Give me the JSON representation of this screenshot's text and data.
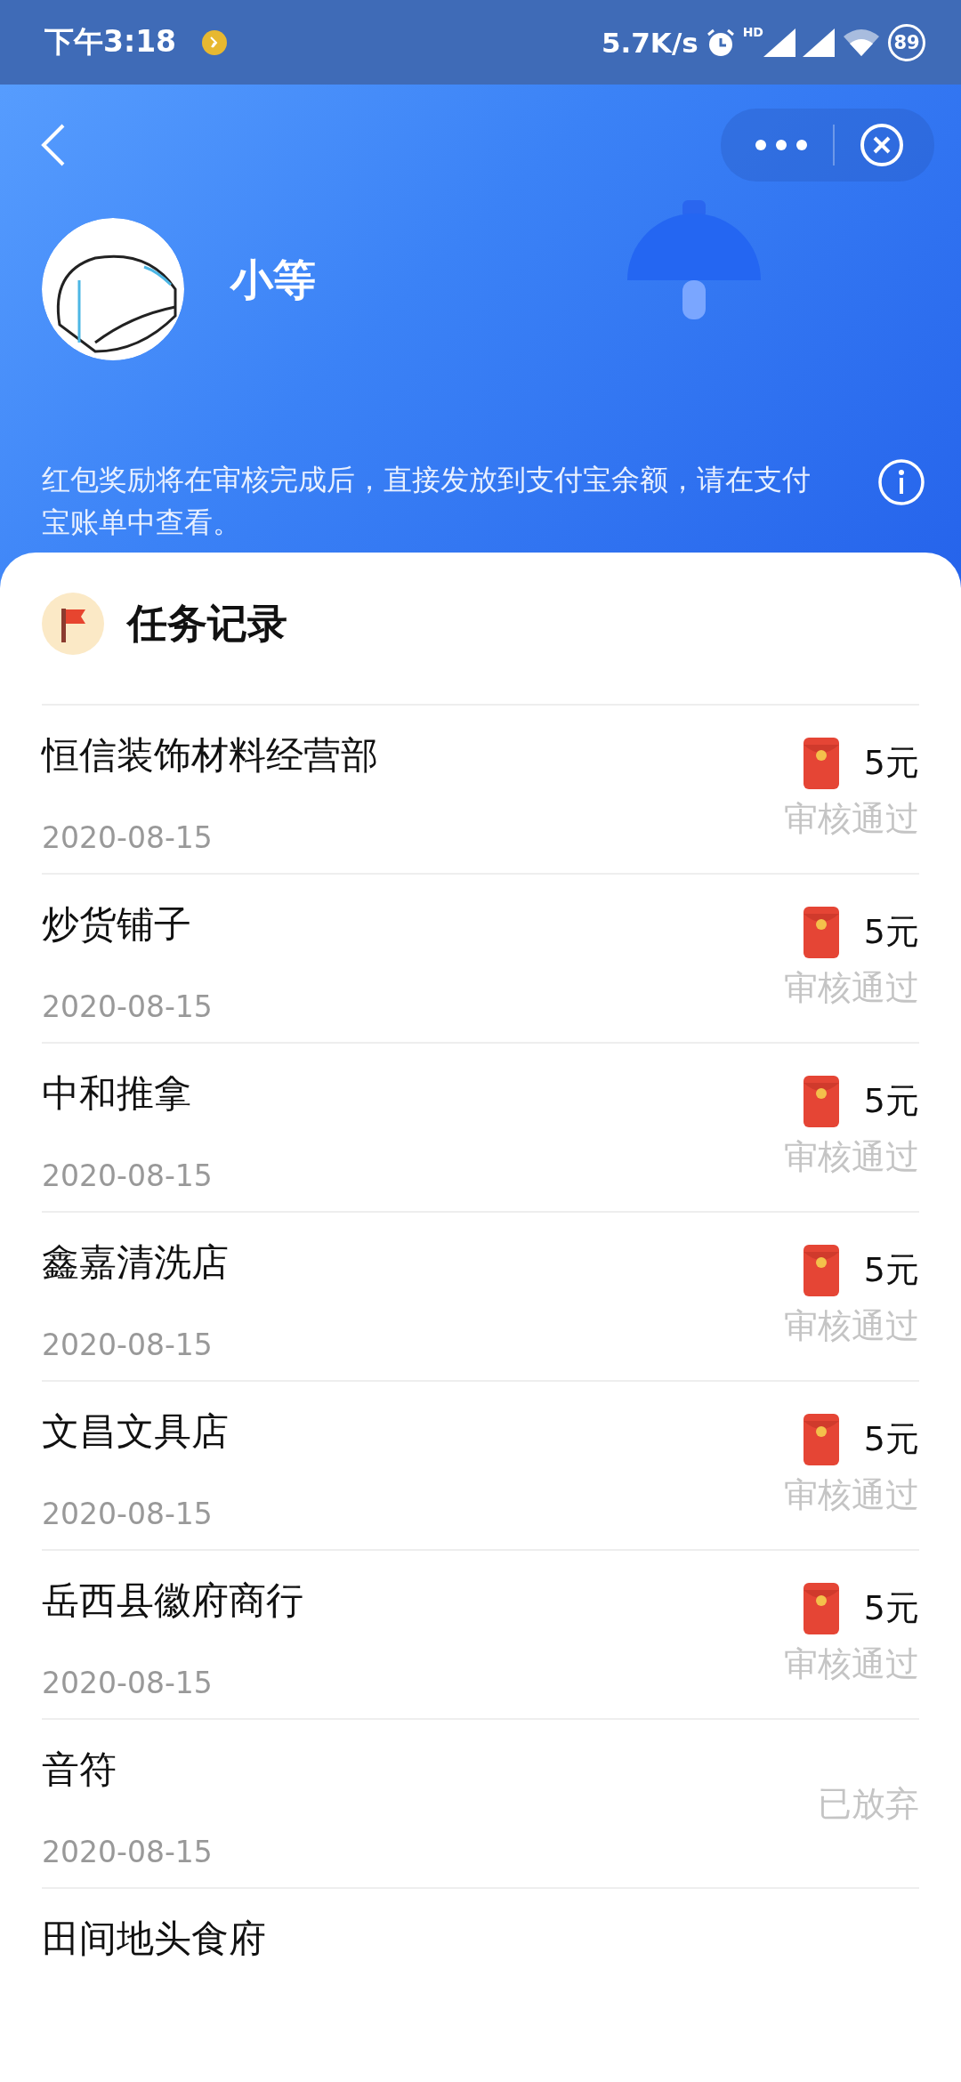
{
  "status_bar": {
    "time": "下午3:18",
    "network_speed": "5.7K/s",
    "hd": "HD",
    "battery": "89"
  },
  "profile": {
    "name": "小等"
  },
  "notice": "红包奖励将在审核完成后，直接发放到支付宝余额，请在支付宝账单中查看。",
  "section_title": "任务记录",
  "records": [
    {
      "name": "恒信装饰材料经营部",
      "date": "2020-08-15",
      "kind": "rewarded",
      "reward": "5元",
      "status": "审核通过"
    },
    {
      "name": "炒货铺子",
      "date": "2020-08-15",
      "kind": "rewarded",
      "reward": "5元",
      "status": "审核通过"
    },
    {
      "name": "中和推拿",
      "date": "2020-08-15",
      "kind": "rewarded",
      "reward": "5元",
      "status": "审核通过"
    },
    {
      "name": "鑫嘉清洗店",
      "date": "2020-08-15",
      "kind": "rewarded",
      "reward": "5元",
      "status": "审核通过"
    },
    {
      "name": "文昌文具店",
      "date": "2020-08-15",
      "kind": "rewarded",
      "reward": "5元",
      "status": "审核通过"
    },
    {
      "name": "岳西县徽府商行",
      "date": "2020-08-15",
      "kind": "rewarded",
      "reward": "5元",
      "status": "审核通过"
    },
    {
      "name": "音符",
      "date": "2020-08-15",
      "kind": "abandoned",
      "status": "已放弃"
    },
    {
      "name": "田间地头食府",
      "kind": "partial"
    }
  ]
}
